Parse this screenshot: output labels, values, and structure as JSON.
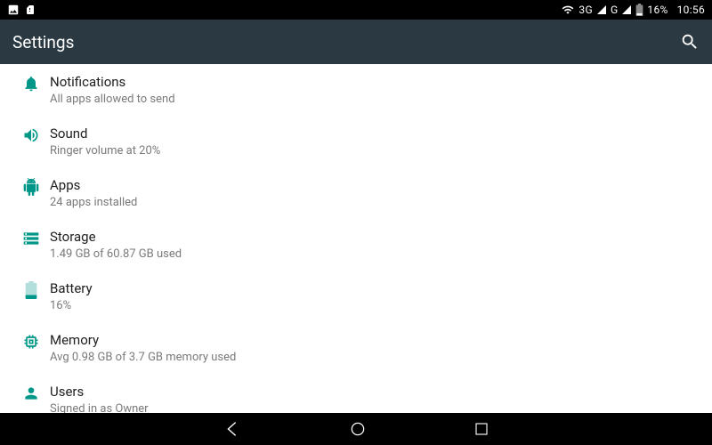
{
  "status": {
    "network": "3G",
    "carrier": "G",
    "battery_pct": "16%",
    "time": "10:56"
  },
  "appbar": {
    "title": "Settings"
  },
  "items": [
    {
      "icon": "bell",
      "title": "Notifications",
      "subtitle": "All apps allowed to send"
    },
    {
      "icon": "volume",
      "title": "Sound",
      "subtitle": "Ringer volume at 20%"
    },
    {
      "icon": "android",
      "title": "Apps",
      "subtitle": "24 apps installed"
    },
    {
      "icon": "storage",
      "title": "Storage",
      "subtitle": "1.49 GB of 60.87 GB used"
    },
    {
      "icon": "battery",
      "title": "Battery",
      "subtitle": "16%"
    },
    {
      "icon": "memory",
      "title": "Memory",
      "subtitle": "Avg 0.98 GB of 3.7 GB memory used"
    },
    {
      "icon": "user",
      "title": "Users",
      "subtitle": "Signed in as Owner"
    }
  ]
}
